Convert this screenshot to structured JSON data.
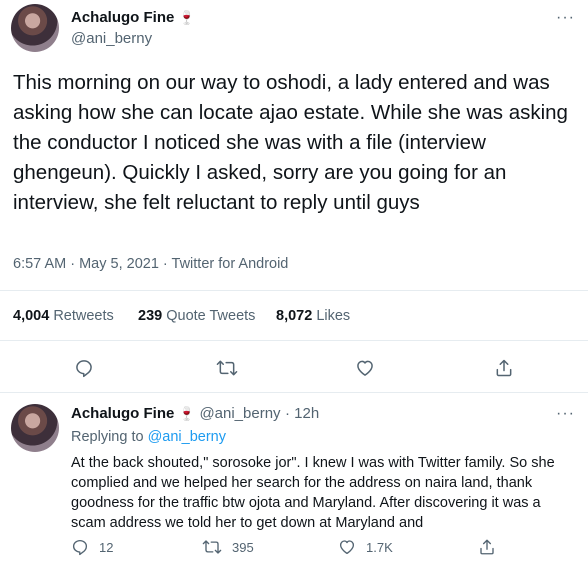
{
  "main_tweet": {
    "author_name": "Achalugo Fine",
    "author_emoji": "🍷",
    "handle": "@ani_berny",
    "text": "This morning on our way to oshodi, a lady entered and was asking how she can locate ajao estate. While she was asking the conductor I noticed she was with a file (interview ghengeun). Quickly I asked, sorry are you going for an interview, she felt reluctant to reply until guys",
    "timestamp": "6:57 AM · May 5, 2021",
    "separator": " · ",
    "source": "Twitter for Android",
    "retweets_count": "4,004",
    "retweets_label": "Retweets",
    "quote_count": "239",
    "quote_label": "Quote Tweets",
    "likes_count": "8,072",
    "likes_label": "Likes",
    "more": "···"
  },
  "reply_tweet": {
    "author_name": "Achalugo Fine",
    "author_emoji": "🍷",
    "handle": "@ani_berny",
    "time": "· 12h",
    "replying_label": "Replying to",
    "replying_to": "@ani_berny",
    "text": "At the back shouted,\" sorosoke jor\". I knew I was with Twitter family. So she complied and we helped her search for the address on naira land, thank goodness for the traffic btw ojota and Maryland. After discovering it was a scam address we told her to get down at Maryland and",
    "reply_count": "12",
    "retweet_count": "395",
    "like_count": "1.7K",
    "more": "···"
  },
  "icons": {
    "reply": "reply-icon",
    "retweet": "retweet-icon",
    "like": "heart-icon",
    "share": "share-icon"
  },
  "colors": {
    "text": "#0f1419",
    "secondary": "#536471",
    "link": "#1d9bf0",
    "divider": "#e6ecf0"
  }
}
